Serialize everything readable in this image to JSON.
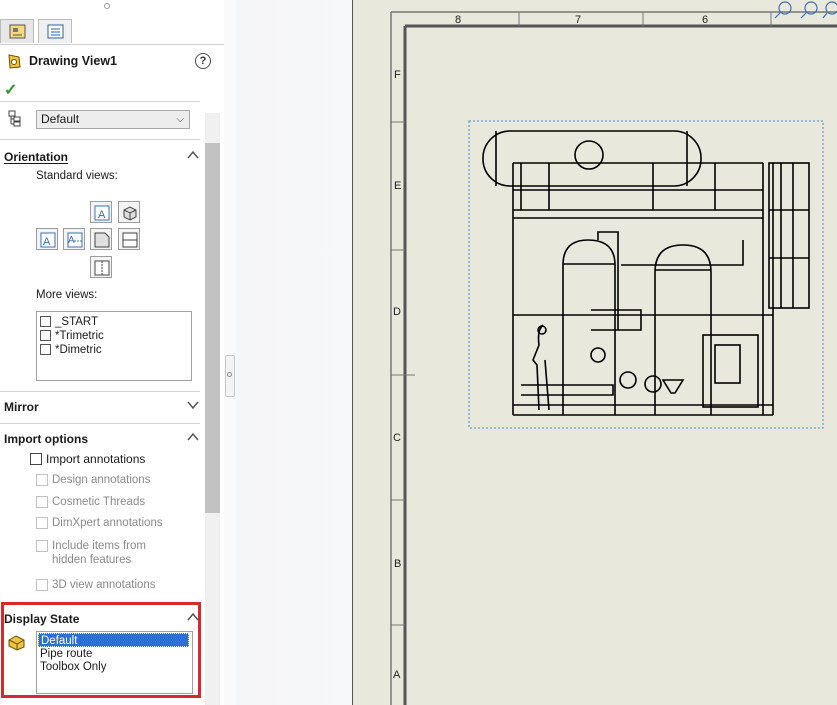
{
  "panel": {
    "title": "Drawing View1",
    "help": "?",
    "ok_symbol": "✓",
    "reference_config": "Default"
  },
  "orientation": {
    "label": "Orientation",
    "standard_views_label": "Standard views:",
    "more_views_label": "More views:",
    "more_views": [
      {
        "label": "_START",
        "checked": false
      },
      {
        "label": "*Trimetric",
        "checked": false
      },
      {
        "label": "*Dimetric",
        "checked": false
      }
    ]
  },
  "mirror": {
    "label": "Mirror"
  },
  "import_options": {
    "label": "Import options",
    "items": [
      {
        "label": "Import annotations",
        "enabled": true
      },
      {
        "label": "Design annotations",
        "enabled": false
      },
      {
        "label": "Cosmetic Threads",
        "enabled": false
      },
      {
        "label": "DimXpert annotations",
        "enabled": false
      },
      {
        "label": "Include items from",
        "label2": "hidden features",
        "enabled": false
      },
      {
        "label": "3D view annotations",
        "enabled": false
      }
    ]
  },
  "display_state": {
    "label": "Display State",
    "items": [
      "Default",
      "Pipe route",
      "Toolbox Only"
    ],
    "selected": "Default"
  },
  "sheet": {
    "columns": [
      "8",
      "7",
      "6"
    ],
    "rows": [
      "F",
      "E",
      "D",
      "C",
      "B",
      "A"
    ]
  },
  "colors": {
    "highlight": "#d62a2a",
    "selection": "#2b70d3",
    "ok": "#2a9a2a"
  }
}
